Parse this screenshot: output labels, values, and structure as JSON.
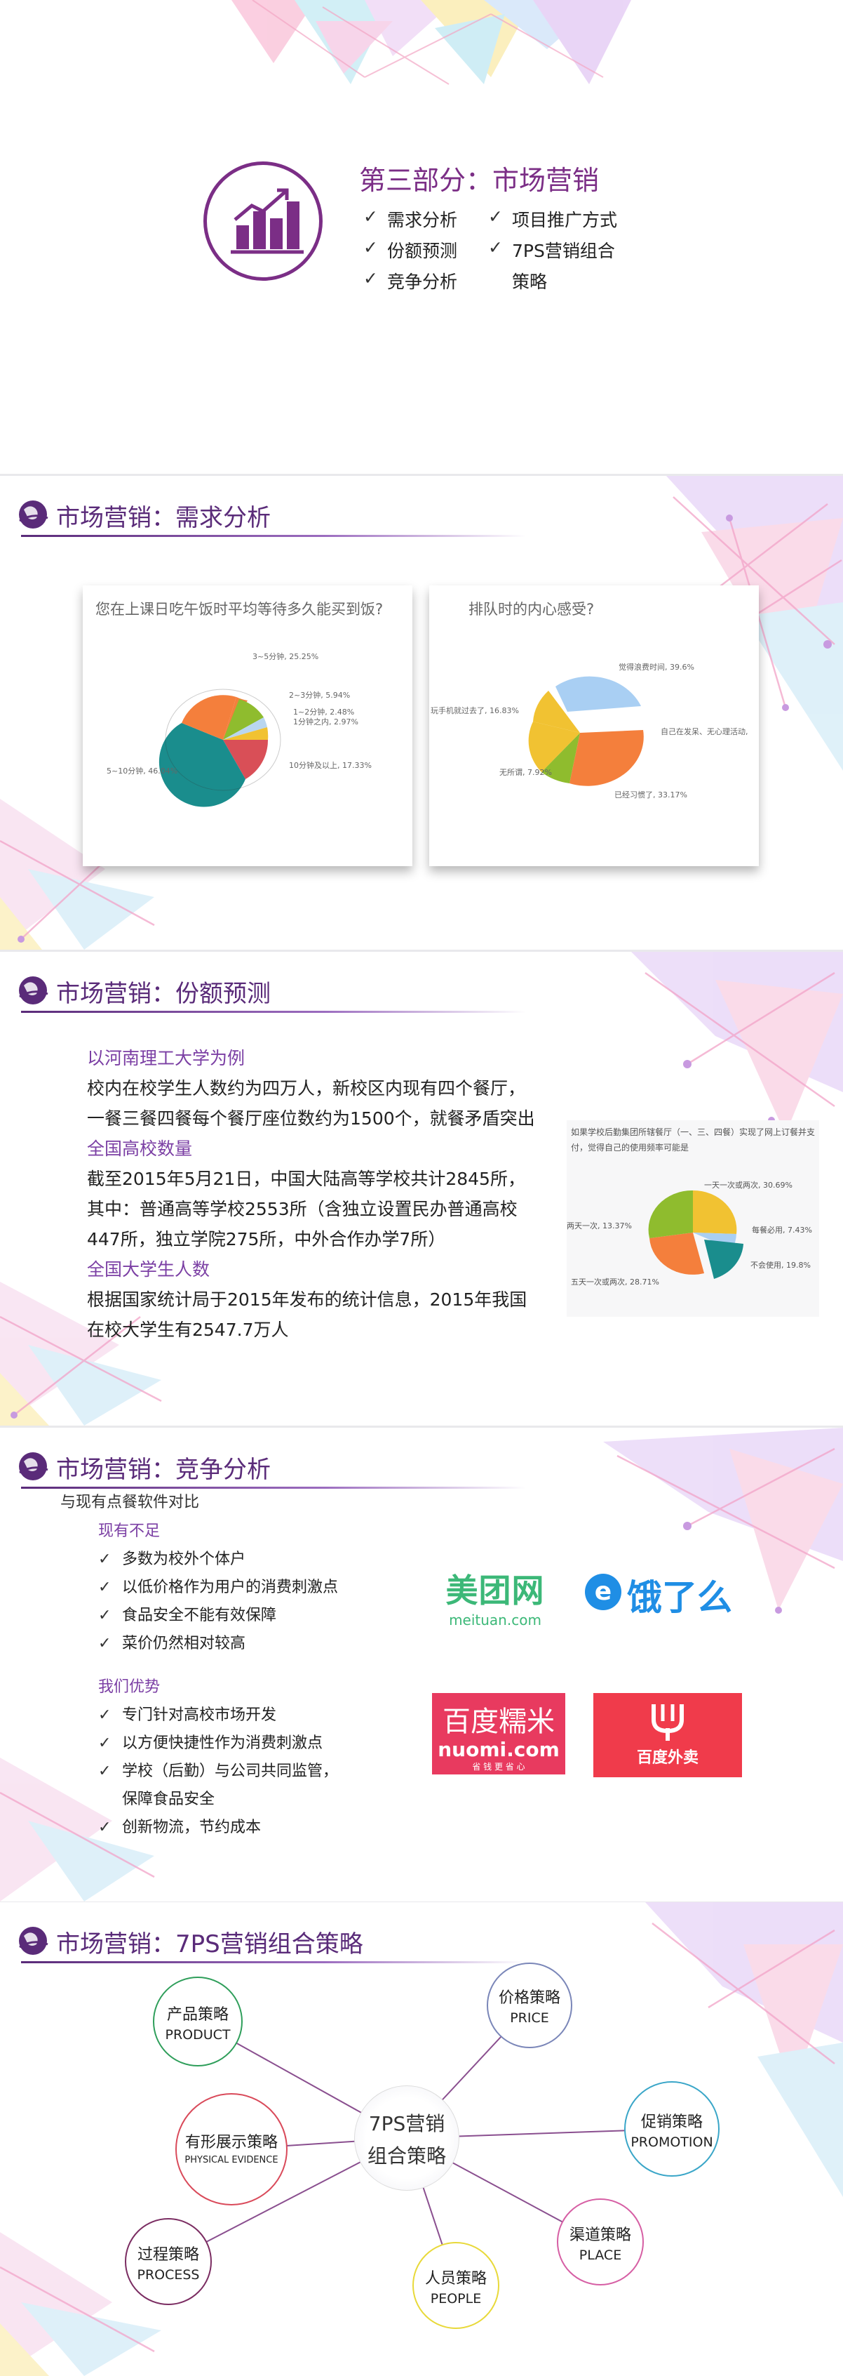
{
  "section_title": {
    "title": "第三部分：市场营销",
    "items": [
      "需求分析",
      "项目推广方式",
      "份额预测",
      "7PS营销组合",
      "竞争分析",
      "策略"
    ]
  },
  "demand": {
    "title": "市场营销：需求分析",
    "chart1": {
      "question": "您在上课日吃午饭时平均等待多久能买到饭?",
      "labels": [
        "3~5分钟, 25.25%",
        "2~3分钟, 5.94%",
        "1~2分钟, 2.48%",
        "1分钟之内, 2.97%",
        "10分钟及以上, 17.33%",
        "5~10分钟, 46.04%"
      ]
    },
    "chart2": {
      "question": "排队时的内心感受?",
      "labels": [
        "觉得浪费时间, 39.6%",
        "自己在发呆、无心理活动,",
        "已经习惯了, 33.17%",
        "无所谓, 7.92%",
        "玩手机就过去了, 16.83%"
      ]
    }
  },
  "share": {
    "title": "市场营销：份额预测",
    "h1": "以河南理工大学为例",
    "p1": "校内在校学生人数约为四万人，新校区内现有四个餐厅，一餐三餐四餐每个餐厅座位数约为1500个，就餐矛盾突出",
    "h2": "全国高校数量",
    "p2": "截至2015年5月21日，中国大陆高等学校共计2845所，其中：普通高等学校2553所（含独立设置民办普通高校447所，独立学院275所，中外合作办学7所）",
    "h3": "全国大学生人数",
    "p3": "根据国家统计局于2015年发布的统计信息，2015年我国在校大学生有2547.7万人",
    "chart_caption": "如果学校后勤集团所辖餐厅（一、三、四餐）实现了网上订餐并支付，觉得自己的使用频率可能是",
    "chart_labels": [
      "一天一次或两次, 30.69%",
      "每餐必用, 7.43%",
      "不会使用, 19.8%",
      "五天一次或两次, 28.71%",
      "两天一次, 13.37%"
    ]
  },
  "competition": {
    "title": "市场营销：竞争分析",
    "intro": "与现有点餐软件对比",
    "h1": "现有不足",
    "list1": [
      "多数为校外个体户",
      "以低价格作为用户的消费刺激点",
      "食品安全不能有效保障",
      "菜价仍然相对较高"
    ],
    "h2": "我们优势",
    "list2": [
      "专门针对高校市场开发",
      "以方便快捷性作为消费刺激点",
      "学校（后勤）与公司共同监管，",
      "保障食品安全",
      "创新物流，节约成本"
    ],
    "logos": {
      "meituan_cn": "美团网",
      "meituan_en": "meituan.com",
      "eleme": "饿了么",
      "nuomi_cn": "百度糯米",
      "nuomi_en": "nuomi.com",
      "nuomi_tag": "省 钱 更 省 心",
      "waimai": "百度外卖"
    }
  },
  "ps7": {
    "title": "市场营销：7PS营销组合策略",
    "center": [
      "7PS营销",
      "组合策略"
    ],
    "nodes": {
      "product": {
        "cn": "产品策略",
        "en": "PRODUCT",
        "color": "#2e9e5a"
      },
      "price": {
        "cn": "价格策略",
        "en": "PRICE",
        "color": "#7a86b8"
      },
      "promotion": {
        "cn": "促销策略",
        "en": "PROMOTION",
        "color": "#3aa6c8"
      },
      "place": {
        "cn": "渠道策略",
        "en": "PLACE",
        "color": "#d65fa4"
      },
      "people": {
        "cn": "人员策略",
        "en": "PEOPLE",
        "color": "#e8d93a"
      },
      "process": {
        "cn": "过程策略",
        "en": "PROCESS",
        "color": "#7b2d62"
      },
      "evidence": {
        "cn": "有形展示策略",
        "en": "PHYSICAL EVIDENCE",
        "color": "#d94a5a"
      }
    }
  },
  "colors": {
    "brand_purple": "#5a2b79",
    "accent_purple": "#7b3fa4"
  }
}
